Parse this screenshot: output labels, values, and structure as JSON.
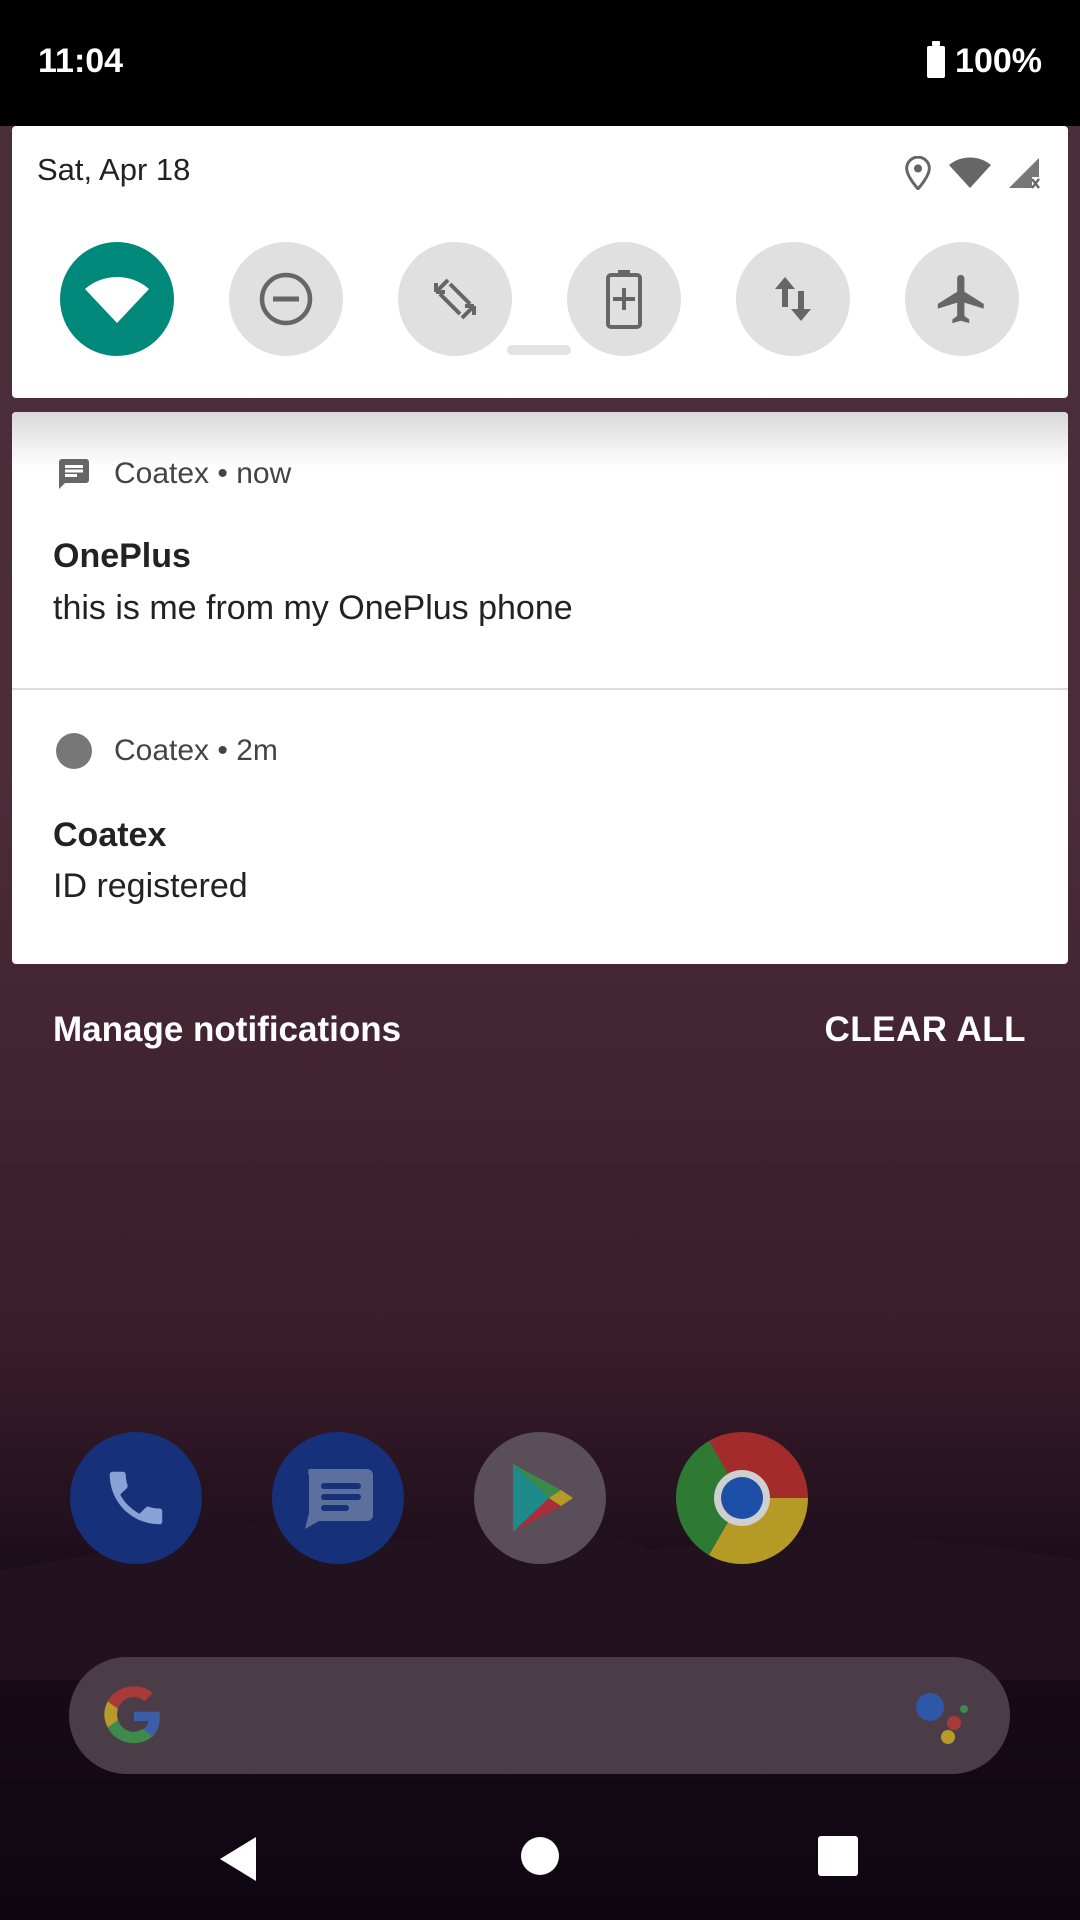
{
  "status_bar": {
    "time": "11:04",
    "battery": "100%"
  },
  "quick_settings": {
    "date": "Sat, Apr 18",
    "tiles": [
      {
        "name": "wifi",
        "active": true
      },
      {
        "name": "do-not-disturb",
        "active": false
      },
      {
        "name": "auto-rotate",
        "active": false
      },
      {
        "name": "battery-saver",
        "active": false
      },
      {
        "name": "mobile-data",
        "active": false
      },
      {
        "name": "airplane-mode",
        "active": false
      }
    ]
  },
  "notifications": [
    {
      "app": "Coatex",
      "time": "now",
      "title": "OnePlus",
      "text": "this is me from my OnePlus phone",
      "icon": "message-icon"
    },
    {
      "app": "Coatex",
      "time": "2m",
      "title": "Coatex",
      "text": "ID registered",
      "icon": "dot-icon"
    }
  ],
  "actions": {
    "manage": "Manage notifications",
    "clear_all": "CLEAR ALL"
  },
  "dock": [
    "phone",
    "messages",
    "play-store",
    "chrome"
  ],
  "colors": {
    "accent": "#00897b",
    "wallpaper_top": "#4a2f3a",
    "wallpaper_bottom": "#0e0611"
  }
}
